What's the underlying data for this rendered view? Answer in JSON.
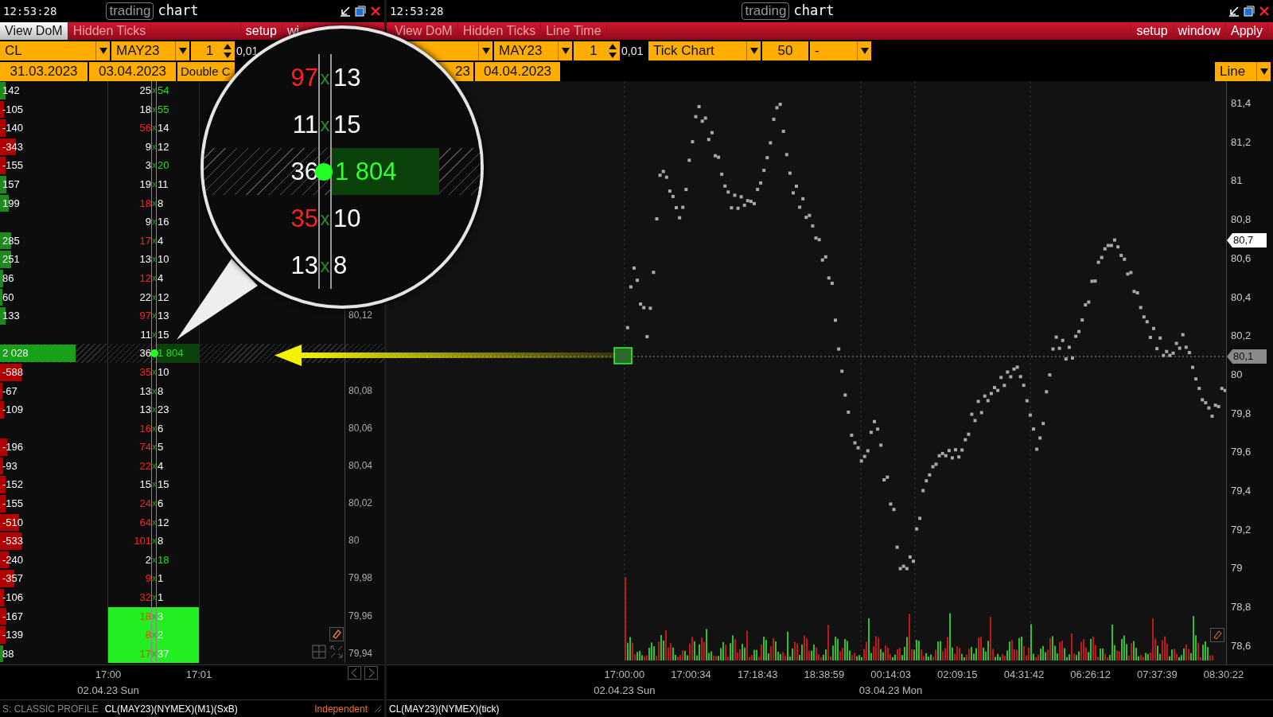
{
  "left_pane": {
    "clock": "12:53:28",
    "badge": "trading",
    "title": "chart",
    "toolbar": [
      {
        "label": "View DoM",
        "kind": "toggle",
        "on": true
      },
      {
        "label": "Hidden Ticks",
        "kind": "toggle",
        "on": false
      },
      {
        "label": "setup",
        "kind": "action"
      },
      {
        "label": "wi",
        "kind": "action"
      }
    ],
    "controls_row1": [
      {
        "kind": "dropdown",
        "value": "CL"
      },
      {
        "kind": "dropdown",
        "value": "MAY23"
      },
      {
        "kind": "spinner",
        "value": "1"
      },
      {
        "kind": "text",
        "value": "0,01"
      }
    ],
    "controls_row2": [
      {
        "kind": "field",
        "value": "31.03.2023"
      },
      {
        "kind": "field",
        "value": "03.04.2023"
      },
      {
        "kind": "field",
        "value": "Double C"
      }
    ],
    "dom": {
      "rows": [
        {
          "volume": "142",
          "color": "#1d8a1d",
          "level": 0.05,
          "bid": "25",
          "bid_highlighted": false,
          "x": "x",
          "ask": "54",
          "ask_highlighted": true,
          "current": false,
          "profile": false
        },
        {
          "volume": "-105",
          "color": "#b00000",
          "level": 0.04,
          "bid": "18",
          "bid_highlighted": false,
          "x": "x",
          "ask": "55",
          "ask_highlighted": true,
          "current": false,
          "profile": false
        },
        {
          "volume": "-140",
          "color": "#b00000",
          "level": 0.05,
          "bid": "56",
          "bid_highlighted": true,
          "x": "x",
          "ask": "14",
          "ask_highlighted": false,
          "current": false,
          "profile": false
        },
        {
          "volume": "-343",
          "color": "#b00000",
          "level": 0.15,
          "bid": "9",
          "bid_highlighted": false,
          "x": "x",
          "ask": "12",
          "ask_highlighted": false,
          "current": false,
          "profile": false
        },
        {
          "volume": "-155",
          "color": "#b00000",
          "level": 0.05,
          "bid": "3",
          "bid_highlighted": false,
          "x": "x",
          "ask": "20",
          "ask_highlighted": true,
          "current": false,
          "profile": false
        },
        {
          "volume": "157",
          "color": "#1d8a1d",
          "level": 0.06,
          "bid": "19",
          "bid_highlighted": false,
          "x": "x",
          "ask": "11",
          "ask_highlighted": false,
          "current": false,
          "profile": false
        },
        {
          "volume": "199",
          "color": "#1d8a1d",
          "level": 0.08,
          "bid": "18",
          "bid_highlighted": true,
          "x": "x",
          "ask": "8",
          "ask_highlighted": false,
          "current": false,
          "profile": false
        },
        {
          "bid": "9",
          "bid_highlighted": false,
          "x": "x",
          "ask": "16",
          "ask_highlighted": false,
          "current": false,
          "profile": false
        },
        {
          "volume": "285",
          "color": "#1d8a1d",
          "level": 0.1,
          "bid": "17",
          "bid_highlighted": true,
          "x": "x",
          "ask": "4",
          "ask_highlighted": false,
          "current": false,
          "profile": false
        },
        {
          "volume": "251",
          "color": "#1d8a1d",
          "level": 0.1,
          "bid": "13",
          "bid_highlighted": false,
          "x": "x",
          "ask": "10",
          "ask_highlighted": false,
          "current": false,
          "profile": false
        },
        {
          "volume": "86",
          "color": "#1d8a1d",
          "level": 0.03,
          "bid": "12",
          "bid_highlighted": true,
          "x": "x",
          "ask": "4",
          "ask_highlighted": false,
          "current": false,
          "profile": false
        },
        {
          "volume": "60",
          "color": "#1d8a1d",
          "level": 0.02,
          "bid": "22",
          "bid_highlighted": false,
          "x": "x",
          "ask": "12",
          "ask_highlighted": false,
          "current": false,
          "profile": false
        },
        {
          "volume": "133",
          "color": "#1d8a1d",
          "level": 0.05,
          "bid": "97",
          "bid_highlighted": true,
          "x": "x",
          "ask": "13",
          "ask_highlighted": false,
          "price": "80,12",
          "current": false,
          "profile": false
        },
        {
          "bid": "11",
          "bid_highlighted": false,
          "x": "x",
          "ask": "15",
          "ask_highlighted": false,
          "current": false,
          "profile": false
        },
        {
          "volume": "2 028",
          "color": "#18a018",
          "level": 0.7,
          "bid": "36",
          "bid_highlighted": false,
          "ask": "1 804",
          "ask_highlighted": true,
          "current": true,
          "profile": false
        },
        {
          "volume": "-588",
          "color": "#b00000",
          "level": 0.2,
          "bid": "35",
          "bid_highlighted": true,
          "x": "x",
          "ask": "10",
          "ask_highlighted": false,
          "current": false,
          "profile": false
        },
        {
          "volume": "-67",
          "color": "#b00000",
          "level": 0.02,
          "bid": "13",
          "bid_highlighted": false,
          "x": "x",
          "ask": "8",
          "ask_highlighted": false,
          "price": "80,08",
          "current": false,
          "profile": false
        },
        {
          "volume": "-109",
          "color": "#b00000",
          "level": 0.04,
          "bid": "13",
          "bid_highlighted": false,
          "x": "x",
          "ask": "23",
          "ask_highlighted": false,
          "current": false,
          "profile": false
        },
        {
          "bid": "16",
          "bid_highlighted": true,
          "x": "x",
          "ask": "6",
          "ask_highlighted": false,
          "price": "80,06",
          "current": false,
          "profile": false
        },
        {
          "volume": "-196",
          "color": "#b00000",
          "level": 0.07,
          "bid": "74",
          "bid_highlighted": true,
          "x": "x",
          "ask": "5",
          "ask_highlighted": false,
          "current": false,
          "profile": false
        },
        {
          "volume": "-93",
          "color": "#b00000",
          "level": 0.03,
          "bid": "22",
          "bid_highlighted": true,
          "x": "x",
          "ask": "4",
          "ask_highlighted": false,
          "price": "80,04",
          "current": false,
          "profile": false
        },
        {
          "volume": "-152",
          "color": "#b00000",
          "level": 0.05,
          "bid": "15",
          "bid_highlighted": false,
          "x": "x",
          "ask": "15",
          "ask_highlighted": false,
          "current": false,
          "profile": false
        },
        {
          "volume": "-155",
          "color": "#b00000",
          "level": 0.05,
          "bid": "24",
          "bid_highlighted": true,
          "x": "x",
          "ask": "6",
          "ask_highlighted": false,
          "price": "80,02",
          "current": false,
          "profile": false
        },
        {
          "volume": "-510",
          "color": "#b00000",
          "level": 0.18,
          "bid": "64",
          "bid_highlighted": true,
          "x": "x",
          "ask": "12",
          "ask_highlighted": false,
          "current": false,
          "profile": false
        },
        {
          "volume": "-533",
          "color": "#b00000",
          "level": 0.2,
          "bid": "101",
          "bid_highlighted": true,
          "x": "x",
          "ask": "8",
          "ask_highlighted": false,
          "price": "80",
          "current": false,
          "profile": false
        },
        {
          "volume": "-240",
          "color": "#b00000",
          "level": 0.08,
          "bid": "2",
          "bid_highlighted": false,
          "x": "x",
          "ask": "18",
          "ask_highlighted": true,
          "current": false,
          "profile": false
        },
        {
          "volume": "-357",
          "color": "#b00000",
          "level": 0.13,
          "bid": "9",
          "bid_highlighted": true,
          "x": "x",
          "ask": "1",
          "ask_highlighted": false,
          "price": "79,98",
          "current": false,
          "profile": false
        },
        {
          "volume": "-106",
          "color": "#b00000",
          "level": 0.04,
          "bid": "32",
          "bid_highlighted": true,
          "x": "x",
          "ask": "1",
          "ask_highlighted": false,
          "current": false,
          "profile": false
        },
        {
          "volume": "-167",
          "color": "#b00000",
          "level": 0.06,
          "bid": "18",
          "bid_highlighted": true,
          "x": "x",
          "ask": "3",
          "ask_highlighted": false,
          "price": "79,96",
          "current": false,
          "profile": true
        },
        {
          "volume": "-139",
          "color": "#b00000",
          "level": 0.05,
          "bid": "8",
          "bid_highlighted": true,
          "x": "x",
          "ask": "2",
          "ask_highlighted": false,
          "current": false,
          "profile": true
        },
        {
          "volume": "88",
          "color": "#1d8a1d",
          "level": 0.03,
          "bid": "17",
          "bid_highlighted": true,
          "x": "x",
          "ask": "37",
          "ask_highlighted": false,
          "price": "79,94",
          "current": false,
          "profile": true
        }
      ]
    },
    "time_axis": [
      {
        "time": "17:00",
        "date": "02.04.23 Sun"
      },
      {
        "time": "17:01"
      }
    ],
    "status": {
      "profile": "S: CLASSIC PROFILE",
      "instrument": "CL(MAY23)(NYMEX)(M1)(SxB)",
      "mode": "Independent"
    }
  },
  "magnifier": {
    "rows": [
      {
        "bid": "97",
        "bid_highlighted": true,
        "x": "x",
        "ask": "13",
        "current": false
      },
      {
        "bid": "11",
        "bid_highlighted": false,
        "x": "x",
        "ask": "15",
        "current": false
      },
      {
        "bid": "36",
        "bid_highlighted": false,
        "ask": "1 804",
        "current": true
      },
      {
        "bid": "35",
        "bid_highlighted": true,
        "x": "x",
        "ask": "10",
        "current": false
      },
      {
        "bid": "13",
        "bid_highlighted": false,
        "x": "x",
        "ask": "8",
        "current": false
      }
    ]
  },
  "right_pane": {
    "clock": "12:53:28",
    "badge": "trading",
    "title": "chart",
    "toolbar": [
      {
        "label": "View DoM",
        "kind": "toggle",
        "on": false
      },
      {
        "label": "Hidden Ticks",
        "kind": "toggle",
        "on": false
      },
      {
        "label": "Line Time",
        "kind": "toggle",
        "on": false
      },
      {
        "label": "setup",
        "kind": "action"
      },
      {
        "label": "window",
        "kind": "action"
      },
      {
        "label": "Apply",
        "kind": "action"
      }
    ],
    "controls_row1": [
      {
        "kind": "dropdown"
      },
      {
        "kind": "dropdown",
        "value": "MAY23"
      },
      {
        "kind": "spinner",
        "value": "1"
      },
      {
        "kind": "text",
        "value": "0,01"
      },
      {
        "kind": "dropdown",
        "value": "Tick Chart"
      },
      {
        "kind": "field",
        "value": "50"
      },
      {
        "kind": "dropdown",
        "value": "-"
      }
    ],
    "controls_row2": [
      {
        "kind": "field",
        "value": "23"
      },
      {
        "kind": "field",
        "value": "04.04.2023"
      }
    ],
    "chart_type": {
      "value": "Line"
    },
    "y_axis": [
      "81,4",
      "81,2",
      "81",
      "80,8",
      "80,6",
      "80,4",
      "80,2",
      "80",
      "79,8",
      "79,6",
      "79,4",
      "79,2",
      "79",
      "78,8",
      "78,6"
    ],
    "price_tags": [
      {
        "text": "80,7",
        "kind": "last"
      },
      {
        "text": "80,1",
        "kind": "cursor"
      }
    ],
    "time_axis": [
      {
        "time": "17:00:00",
        "date": "02.04.23 Sun"
      },
      {
        "time": "17:00:34"
      },
      {
        "time": "17:18:43"
      },
      {
        "time": "18:38:59"
      },
      {
        "time": "00:14:03",
        "date": "03.04.23 Mon"
      },
      {
        "time": "02:09:15"
      },
      {
        "time": "04:31:42"
      },
      {
        "time": "06:26:12"
      },
      {
        "time": "07:37:39"
      },
      {
        "time": "08:30:22"
      }
    ],
    "status": {
      "instrument": "CL(MAY23)(NYMEX)(tick)"
    }
  }
}
